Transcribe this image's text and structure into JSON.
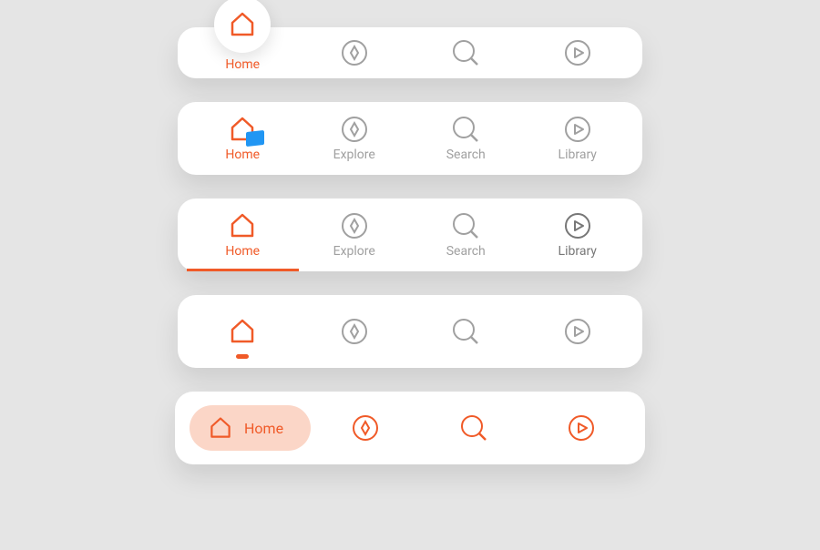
{
  "colors": {
    "accent": "#f05a28",
    "accent_light": "#fbd6c7",
    "grey": "#a0a0a0",
    "grey_dark": "#777777",
    "badge": "#2196f3",
    "bg": "#e5e5e5",
    "card": "#ffffff"
  },
  "labels": {
    "home": "Home",
    "explore": "Explore",
    "search": "Search",
    "library": "Library"
  },
  "bars": [
    {
      "style": "floating-selected",
      "items": [
        {
          "icon": "home",
          "label": "Home",
          "active": true,
          "show_label": true
        },
        {
          "icon": "explore",
          "label": "Explore",
          "active": false,
          "show_label": false
        },
        {
          "icon": "search",
          "label": "Search",
          "active": false,
          "show_label": false
        },
        {
          "icon": "play",
          "label": "Library",
          "active": false,
          "show_label": false
        }
      ]
    },
    {
      "style": "labeled-badge",
      "items": [
        {
          "icon": "home",
          "label": "Home",
          "active": true,
          "badge": true
        },
        {
          "icon": "explore",
          "label": "Explore",
          "active": false
        },
        {
          "icon": "search",
          "label": "Search",
          "active": false
        },
        {
          "icon": "play",
          "label": "Library",
          "active": false
        }
      ]
    },
    {
      "style": "underline",
      "items": [
        {
          "icon": "home",
          "label": "Home",
          "active": true,
          "underline": true
        },
        {
          "icon": "explore",
          "label": "Explore",
          "active": false
        },
        {
          "icon": "search",
          "label": "Search",
          "active": false
        },
        {
          "icon": "play",
          "label": "Library",
          "active": false
        }
      ]
    },
    {
      "style": "dot-indicator",
      "items": [
        {
          "icon": "home",
          "label": "Home",
          "active": true,
          "show_label": false,
          "dot": true
        },
        {
          "icon": "explore",
          "label": "Explore",
          "active": false,
          "show_label": false
        },
        {
          "icon": "search",
          "label": "Search",
          "active": false,
          "show_label": false
        },
        {
          "icon": "play",
          "label": "Library",
          "active": false,
          "show_label": false
        }
      ]
    },
    {
      "style": "pill-selected",
      "items": [
        {
          "icon": "home",
          "label": "Home",
          "active": true,
          "pill": true,
          "show_label": true
        },
        {
          "icon": "explore",
          "label": "Explore",
          "active": false,
          "show_label": false
        },
        {
          "icon": "search",
          "label": "Search",
          "active": false,
          "show_label": false
        },
        {
          "icon": "play",
          "label": "Library",
          "active": false,
          "show_label": false
        }
      ]
    }
  ]
}
